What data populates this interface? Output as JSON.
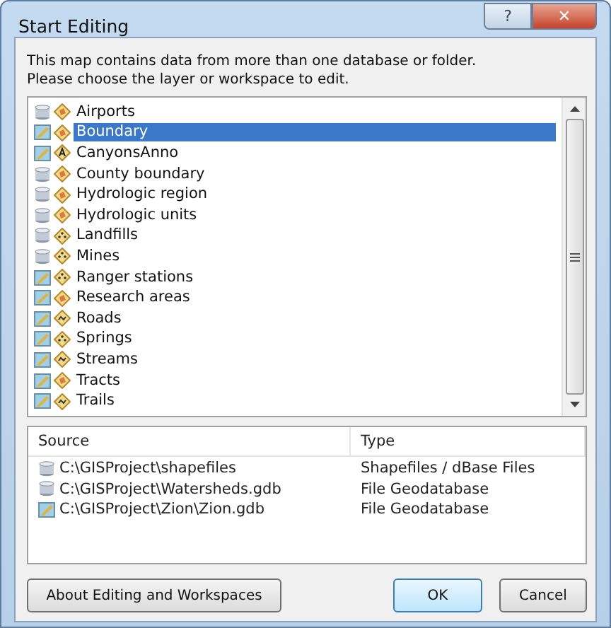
{
  "window": {
    "title": "Start Editing",
    "controls": [
      "?",
      "✕"
    ]
  },
  "instructions": [
    "This map contains data from more than one database or folder.",
    "Please choose the layer or workspace to edit."
  ],
  "layers": [
    {
      "name": "Airports",
      "workspace_icon": {
        "kind": "db"
      },
      "layer_icon": {
        "kind": "polygon"
      },
      "selected": false
    },
    {
      "name": "Boundary",
      "workspace_icon": {
        "kind": "edit"
      },
      "layer_icon": {
        "kind": "polygon"
      },
      "selected": true
    },
    {
      "name": "CanyonsAnno",
      "workspace_icon": {
        "kind": "edit"
      },
      "layer_icon": {
        "kind": "annotation"
      },
      "selected": false
    },
    {
      "name": "County boundary",
      "workspace_icon": {
        "kind": "db"
      },
      "layer_icon": {
        "kind": "polygon"
      },
      "selected": false
    },
    {
      "name": "Hydrologic region",
      "workspace_icon": {
        "kind": "db"
      },
      "layer_icon": {
        "kind": "polygon"
      },
      "selected": false
    },
    {
      "name": "Hydrologic units",
      "workspace_icon": {
        "kind": "db"
      },
      "layer_icon": {
        "kind": "polygon"
      },
      "selected": false
    },
    {
      "name": "Landfills",
      "workspace_icon": {
        "kind": "db"
      },
      "layer_icon": {
        "kind": "point"
      },
      "selected": false
    },
    {
      "name": "Mines",
      "workspace_icon": {
        "kind": "db"
      },
      "layer_icon": {
        "kind": "point"
      },
      "selected": false
    },
    {
      "name": "Ranger stations",
      "workspace_icon": {
        "kind": "edit"
      },
      "layer_icon": {
        "kind": "point"
      },
      "selected": false
    },
    {
      "name": "Research areas",
      "workspace_icon": {
        "kind": "edit"
      },
      "layer_icon": {
        "kind": "polygon"
      },
      "selected": false
    },
    {
      "name": "Roads",
      "workspace_icon": {
        "kind": "edit"
      },
      "layer_icon": {
        "kind": "line"
      },
      "selected": false
    },
    {
      "name": "Springs",
      "workspace_icon": {
        "kind": "edit"
      },
      "layer_icon": {
        "kind": "point"
      },
      "selected": false
    },
    {
      "name": "Streams",
      "workspace_icon": {
        "kind": "edit"
      },
      "layer_icon": {
        "kind": "line"
      },
      "selected": false
    },
    {
      "name": "Tracts",
      "workspace_icon": {
        "kind": "edit"
      },
      "layer_icon": {
        "kind": "polygon"
      },
      "selected": false
    },
    {
      "name": "Trails",
      "workspace_icon": {
        "kind": "edit"
      },
      "layer_icon": {
        "kind": "line"
      },
      "selected": false
    }
  ],
  "sources": {
    "columns": [
      "Source",
      "Type"
    ],
    "rows": [
      {
        "icon": {
          "kind": "db"
        },
        "source": "C:\\GISProject\\shapefiles",
        "type": "Shapefiles / dBase Files"
      },
      {
        "icon": {
          "kind": "db"
        },
        "source": "C:\\GISProject\\Watersheds.gdb",
        "type": "File Geodatabase"
      },
      {
        "icon": {
          "kind": "edit"
        },
        "source": "C:\\GISProject\\Zion\\Zion.gdb",
        "type": "File Geodatabase"
      }
    ]
  },
  "buttons": [
    {
      "label": "About Editing and Workspaces",
      "kind": "help"
    },
    {
      "label": "OK",
      "kind": "default"
    },
    {
      "label": "Cancel",
      "kind": "normal"
    }
  ]
}
